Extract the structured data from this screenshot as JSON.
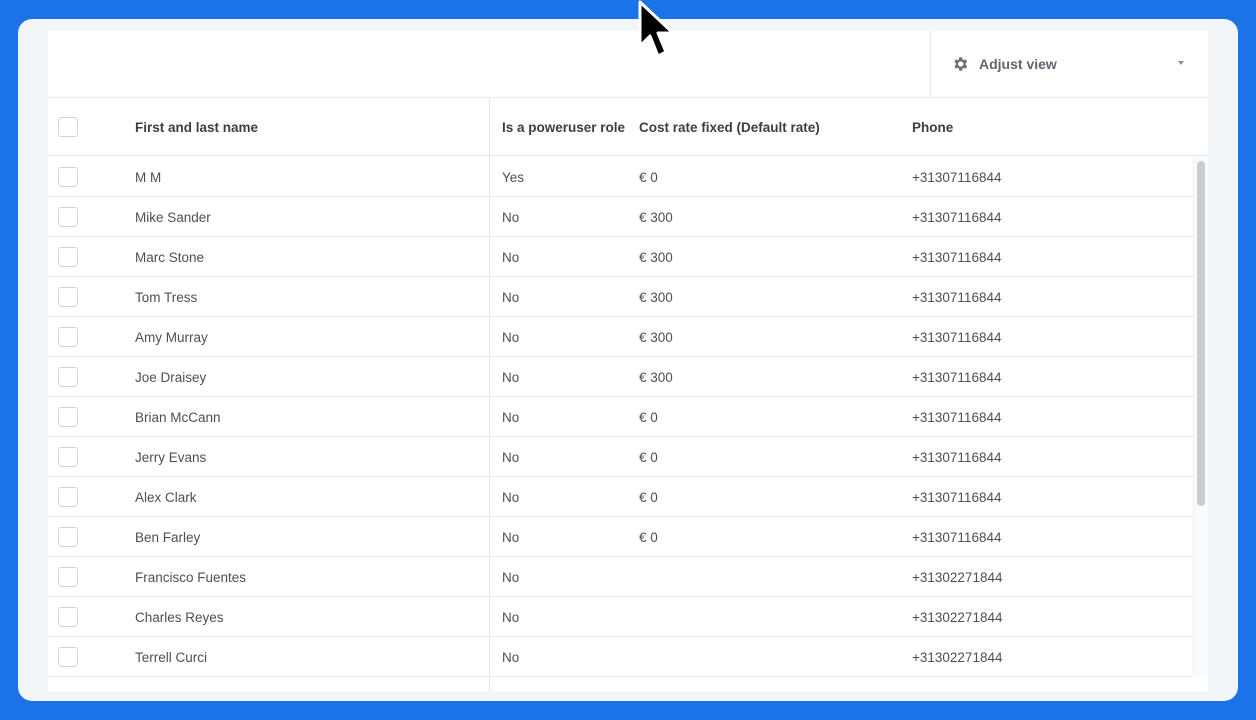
{
  "toolbar": {
    "adjust_view_label": "Adjust view",
    "adjust_view_icon": "gear-icon",
    "dropdown_icon": "caret-down-icon"
  },
  "table": {
    "columns": [
      "First and last name",
      "Is a poweruser role",
      "Cost rate fixed (Default rate)",
      "Phone"
    ],
    "rows": [
      {
        "name": "M M",
        "poweruser": "Yes",
        "cost": "€ 0",
        "phone": "+31307116844"
      },
      {
        "name": "Mike Sander",
        "poweruser": "No",
        "cost": "€ 300",
        "phone": "+31307116844"
      },
      {
        "name": "Marc Stone",
        "poweruser": "No",
        "cost": "€ 300",
        "phone": "+31307116844"
      },
      {
        "name": "Tom Tress",
        "poweruser": "No",
        "cost": "€ 300",
        "phone": "+31307116844"
      },
      {
        "name": "Amy Murray",
        "poweruser": "No",
        "cost": "€ 300",
        "phone": "+31307116844"
      },
      {
        "name": "Joe Draisey",
        "poweruser": "No",
        "cost": "€ 300",
        "phone": "+31307116844"
      },
      {
        "name": "Brian McCann",
        "poweruser": "No",
        "cost": "€ 0",
        "phone": "+31307116844"
      },
      {
        "name": "Jerry Evans",
        "poweruser": "No",
        "cost": "€ 0",
        "phone": "+31307116844"
      },
      {
        "name": "Alex Clark",
        "poweruser": "No",
        "cost": "€ 0",
        "phone": "+31307116844"
      },
      {
        "name": "Ben Farley",
        "poweruser": "No",
        "cost": "€ 0",
        "phone": "+31307116844"
      },
      {
        "name": "Francisco Fuentes",
        "poweruser": "No",
        "cost": "",
        "phone": "+31302271844"
      },
      {
        "name": "Charles Reyes",
        "poweruser": "No",
        "cost": "",
        "phone": "+31302271844"
      },
      {
        "name": "Terrell Curci",
        "poweruser": "No",
        "cost": "",
        "phone": "+31302271844"
      }
    ]
  },
  "colors": {
    "background": "#1a73e8",
    "card": "#f3f6f8",
    "text": "#4a5058",
    "header_text": "#3a3f46"
  }
}
